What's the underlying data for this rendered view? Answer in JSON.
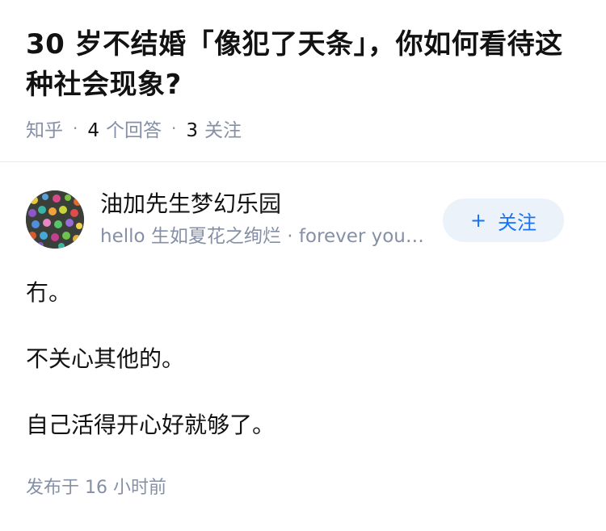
{
  "question": {
    "title": "30 岁不结婚「像犯了天条」，你如何看待这种社会现象?",
    "source": "知乎",
    "answers_count": "4",
    "answers_label": "个回答",
    "followers_count": "3",
    "followers_label": "关注"
  },
  "answer": {
    "author": {
      "name": "油加先生梦幻乐园",
      "bio": "hello 生如夏花之绚烂 · forever young"
    },
    "follow_button": {
      "icon": "+",
      "label": "关注"
    },
    "paragraphs": [
      "冇。",
      "不关心其他的。",
      "自己活得开心好就够了。"
    ],
    "published": "发布于 16 小时前"
  },
  "colors": {
    "text": "#121212",
    "meta": "#8590a6",
    "accent": "#1772f6",
    "button_bg": "#ebf2fa"
  }
}
